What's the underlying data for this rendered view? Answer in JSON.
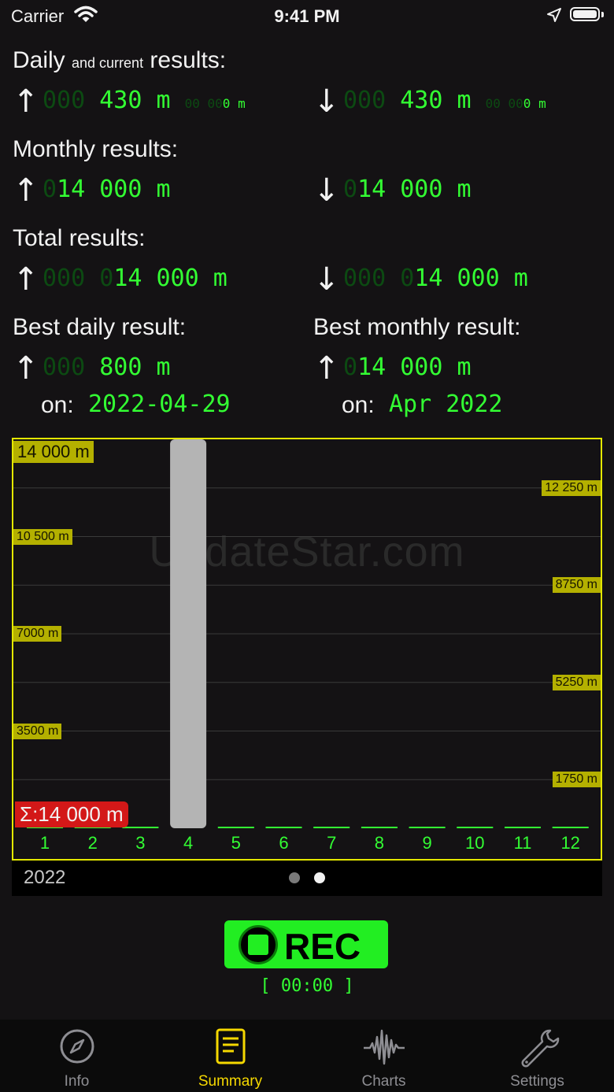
{
  "status_bar": {
    "carrier": "Carrier",
    "time": "9:41 PM"
  },
  "sections": {
    "daily": {
      "title_pre": "Daily ",
      "title_small": "and current",
      "title_post": " results:",
      "up": {
        "dim": "000 ",
        "main": "430 m",
        "sub_dim": "00 00",
        "sub": "0 m"
      },
      "down": {
        "dim": "000 ",
        "main": "430 m",
        "sub_dim": "00 00",
        "sub": "0 m"
      }
    },
    "monthly": {
      "title": "Monthly results:",
      "up": {
        "dim": "0",
        "main": "14 000 m"
      },
      "down": {
        "dim": "0",
        "main": "14 000 m"
      }
    },
    "total": {
      "title": "Total results:",
      "up": {
        "dim": "000 0",
        "main": "14 000 m"
      },
      "down": {
        "dim": "000 0",
        "main": "14 000 m"
      }
    },
    "best_daily": {
      "title": "Best daily result:",
      "up": {
        "dim": "000 ",
        "main": "800 m"
      },
      "on_label": "on:",
      "on_value": "2022-04-29"
    },
    "best_monthly": {
      "title": "Best monthly result:",
      "up": {
        "dim": "0",
        "main": "14 000 m"
      },
      "on_label": "on:",
      "on_value": "Apr 2022"
    }
  },
  "chart_data": {
    "type": "bar",
    "categories": [
      "1",
      "2",
      "3",
      "4",
      "5",
      "6",
      "7",
      "8",
      "9",
      "10",
      "11",
      "12"
    ],
    "values": [
      0,
      0,
      0,
      14000,
      0,
      0,
      0,
      0,
      0,
      0,
      0,
      0
    ],
    "ylim": [
      0,
      14000
    ],
    "y_tick_labels": [
      "14 000 m",
      "12 250 m",
      "10 500 m",
      "8750 m",
      "7000 m",
      "5250 m",
      "3500 m",
      "1750 m"
    ],
    "sum_label": "Σ:14 000 m",
    "grid": true,
    "colors": {
      "bar": "#b4b4b4",
      "axis": "#e4e800",
      "empty_bar": "#33ff33",
      "sum_badge": "#d31818"
    }
  },
  "watermark": "UpdateStar.com",
  "pager": {
    "year": "2022",
    "pages": 2,
    "active_page": 2
  },
  "recorder": {
    "label": "REC",
    "timer": "[ 00:00 ]"
  },
  "tabs": [
    {
      "label": "Info",
      "icon": "compass-icon",
      "active": false
    },
    {
      "label": "Summary",
      "icon": "document-icon",
      "active": true
    },
    {
      "label": "Charts",
      "icon": "waveform-icon",
      "active": false
    },
    {
      "label": "Settings",
      "icon": "wrench-icon",
      "active": false
    }
  ],
  "colors": {
    "accent_green": "#33ff33",
    "dim_green": "#0c4a12",
    "tab_active": "#f5d800",
    "background": "#141214"
  }
}
